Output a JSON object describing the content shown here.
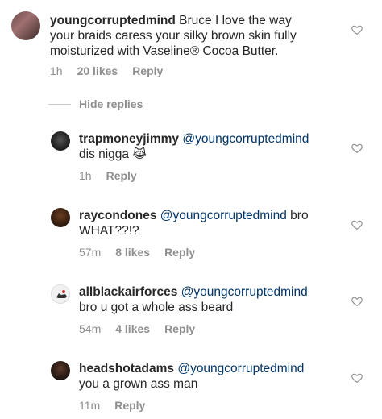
{
  "main_comment": {
    "username": "youngcorruptedmind",
    "text": "Bruce I love the way your braids caress your silky brown skin fully moisturized with Vaseline® Cocoa Butter.",
    "line1": "Bruce I love the way",
    "line2": "your braids caress your silky brown skin fully",
    "line3": "moisturized with Vaseline® Cocoa Butter.",
    "time": "1h",
    "likes": "20 likes",
    "reply": "Reply"
  },
  "hide_replies_label": "Hide replies",
  "replies": [
    {
      "username": "trapmoneyjimmy",
      "mention": "@youngcorruptedmind",
      "text": "dis nigga",
      "emoji": "😹",
      "time": "1h",
      "likes": "",
      "reply": "Reply"
    },
    {
      "username": "raycondones",
      "mention": "@youngcorruptedmind",
      "text_inline": "bro",
      "text_line2": "WHAT??!?",
      "time": "57m",
      "likes": "8 likes",
      "reply": "Reply"
    },
    {
      "username": "allblackairforces",
      "mention": "@youngcorruptedmind",
      "text": "bro u got a whole ass beard",
      "time": "54m",
      "likes": "4 likes",
      "reply": "Reply"
    },
    {
      "username": "headshotadams",
      "mention": "@youngcorruptedmind",
      "text": "you a grown ass man",
      "time": "11m",
      "likes": "",
      "reply": "Reply"
    }
  ],
  "icons": {
    "heart": "heart-outline-icon",
    "avatar": "avatar"
  }
}
